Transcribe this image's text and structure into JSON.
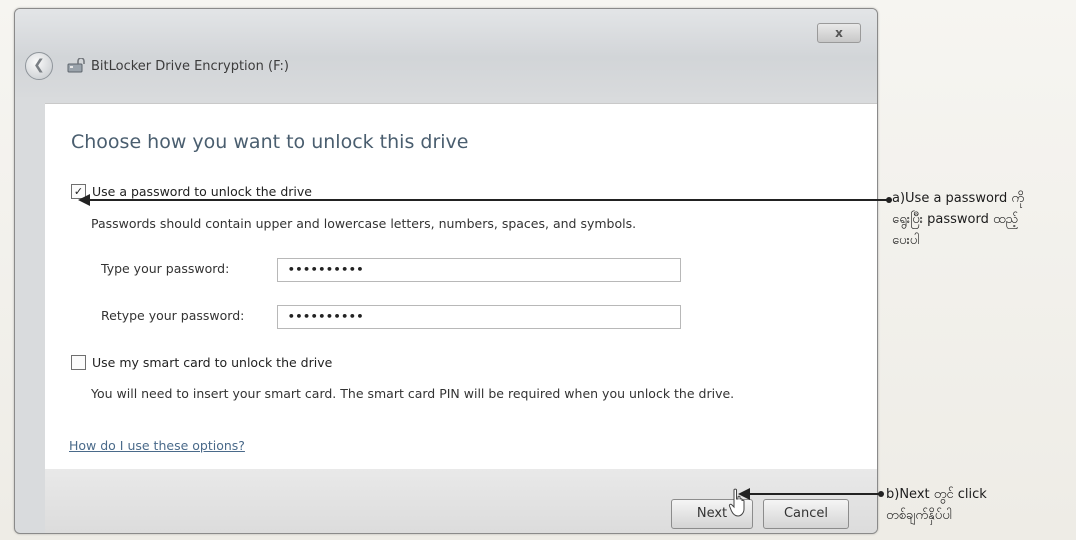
{
  "window": {
    "title": "BitLocker Drive Encryption (F:)",
    "close_label": "x",
    "back_icon": "back-arrow-icon"
  },
  "main": {
    "heading": "Choose how you want to unlock this drive",
    "password_option": {
      "checked": true,
      "label": "Use a password to unlock the drive",
      "description": "Passwords should contain upper and lowercase letters, numbers, spaces, and symbols.",
      "type_label": "Type your password:",
      "type_value": "••••••••••",
      "retype_label": "Retype your password:",
      "retype_value": "••••••••••"
    },
    "smartcard_option": {
      "checked": false,
      "label": "Use my smart card to unlock the drive",
      "description": "You will need to insert your smart card. The smart card PIN will be required when you unlock the drive."
    },
    "help_link": "How do I use these options?"
  },
  "footer": {
    "next_label": "Next",
    "cancel_label": "Cancel"
  },
  "annotations": {
    "a_line1": "a)Use a password ကို",
    "a_line2": "ရွေးပြီး password ထည့်",
    "a_line3": "ပေးပါ",
    "b_line1": "b)Next တွင် click",
    "b_line2": "တစ်ချက်နှိပ်ပါ"
  }
}
